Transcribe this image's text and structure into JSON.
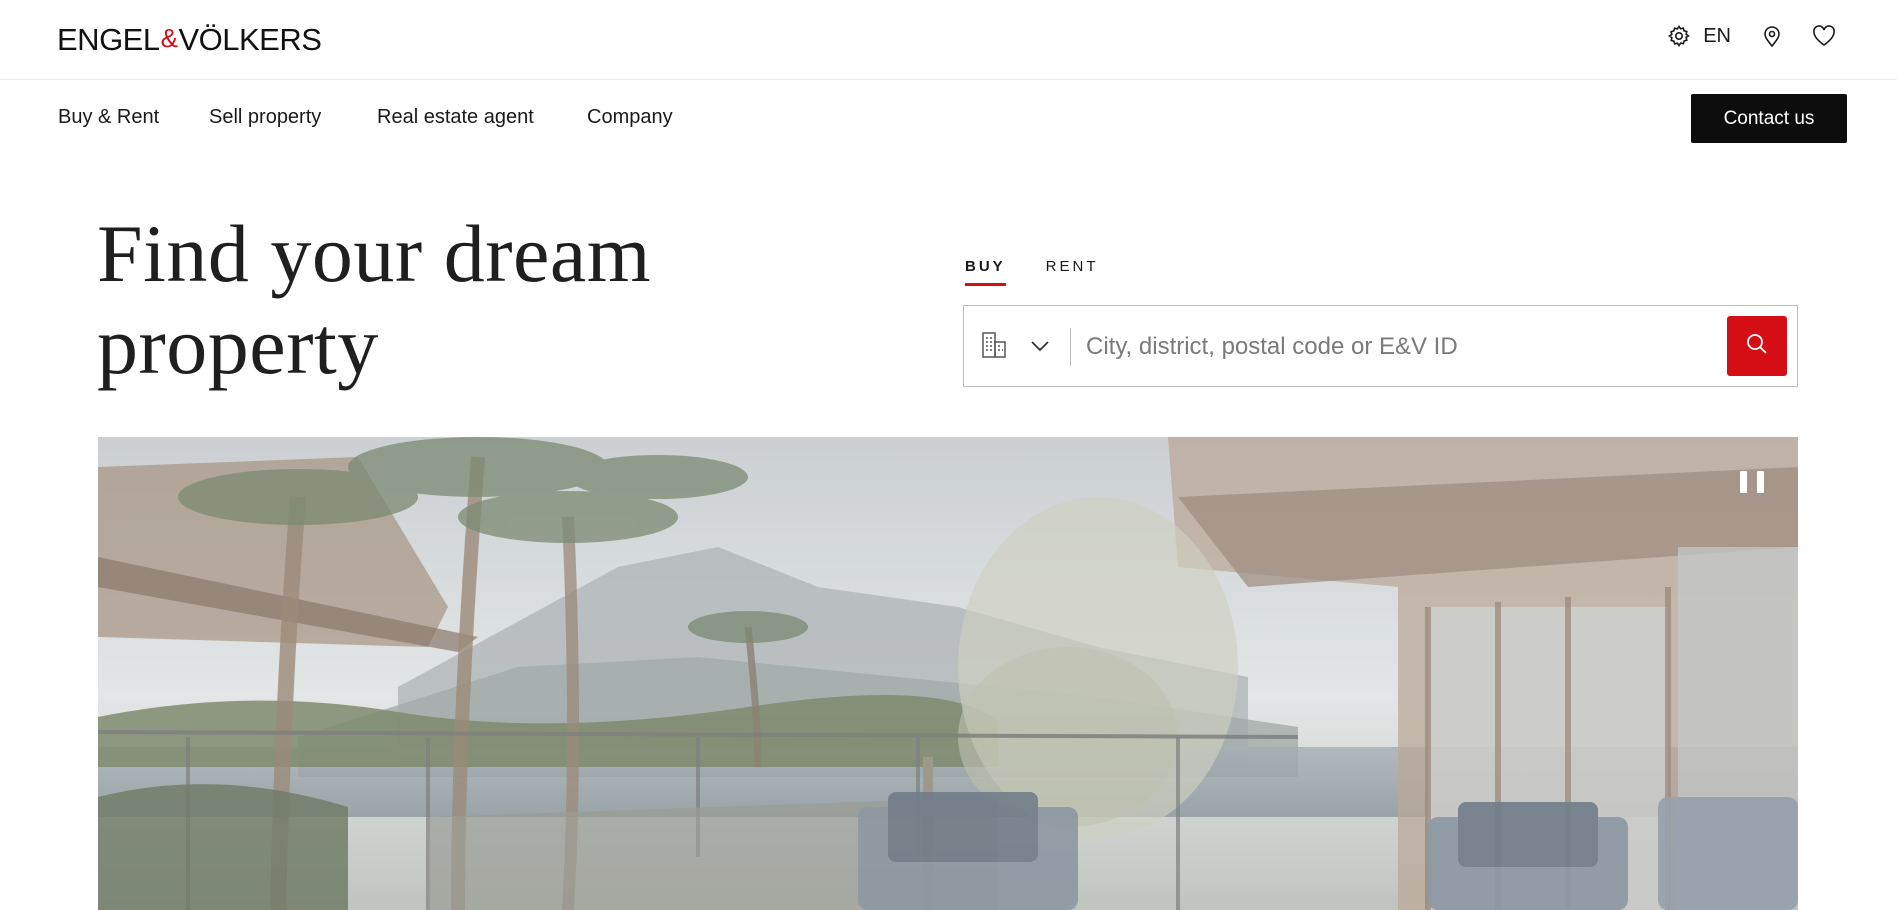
{
  "brand": {
    "name_left": "ENGEL",
    "ampersand": "&",
    "name_right": "VÖLKERS",
    "accent_color": "#d40e14"
  },
  "header": {
    "settings_icon": "gear-icon",
    "language": "EN",
    "location_icon": "map-pin-icon",
    "favorites_icon": "heart-icon"
  },
  "nav": {
    "items": [
      {
        "label": "Buy & Rent"
      },
      {
        "label": "Sell property"
      },
      {
        "label": "Real estate agent"
      },
      {
        "label": "Company"
      }
    ],
    "contact_label": "Contact us"
  },
  "hero": {
    "title_line1": "Find your dream",
    "title_line2": "property"
  },
  "search": {
    "tabs": [
      {
        "label": "BUY",
        "active": true
      },
      {
        "label": "RENT",
        "active": false
      }
    ],
    "property_type_icon": "building-icon",
    "dropdown_icon": "chevron-down-icon",
    "placeholder": "City, district, postal code or E&V ID",
    "value": "",
    "search_icon": "search-icon"
  },
  "media": {
    "pause_icon": "pause-icon"
  }
}
